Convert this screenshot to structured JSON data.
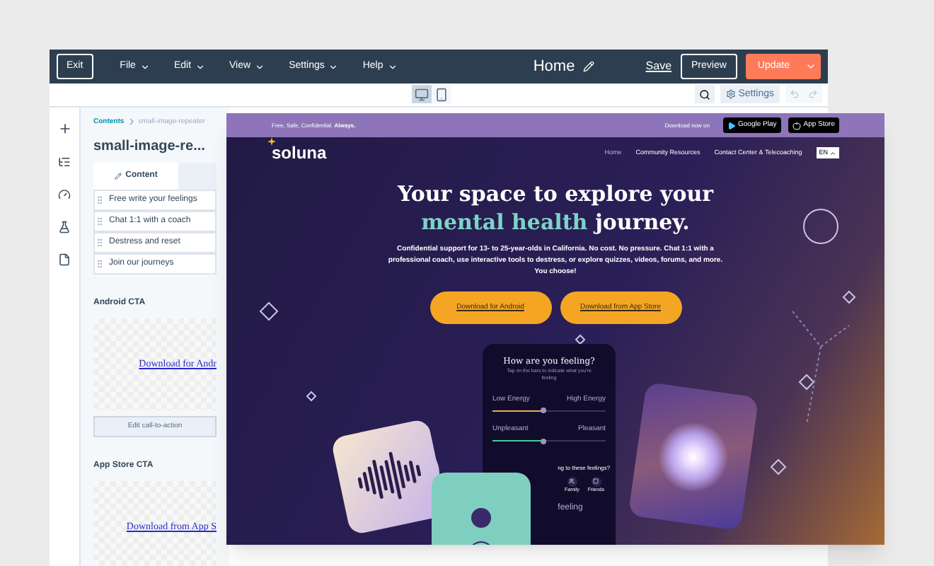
{
  "editor": {
    "exit": "Exit",
    "menus": [
      "File",
      "Edit",
      "View",
      "Settings",
      "Help"
    ],
    "page_title": "Home",
    "save": "Save",
    "preview": "Preview",
    "update": "Update",
    "devices": [
      {
        "kind": "desktop",
        "selected": true
      },
      {
        "kind": "mobile",
        "selected": false
      }
    ],
    "settings": "Settings"
  },
  "sidebar": {
    "breadcrumb": [
      "Contents",
      "small-image-repeater"
    ],
    "title": "small-image-re...",
    "tab": "Content",
    "items": [
      "Free write your feelings",
      "Chat 1:1 with a coach",
      "Destress and reset",
      "Join our journeys"
    ],
    "sections": [
      {
        "heading": "Android CTA",
        "link": "Download for Andr",
        "button": "Edit call-to-action"
      },
      {
        "heading": "App Store CTA",
        "link": "Download from App S"
      }
    ]
  },
  "site": {
    "tagline": "Free, Safe, Confidential. ",
    "tagline_bold": "Always.",
    "download_label": "Download now on",
    "stores": [
      {
        "name": "Google Play"
      },
      {
        "name": "App Store"
      }
    ],
    "logo": "soluna",
    "nav": [
      {
        "label": "Home",
        "selected": true
      },
      {
        "label": "Community Resources",
        "selected": false
      },
      {
        "label": "Contact Center & Telecoaching",
        "selected": false
      }
    ],
    "language": "EN",
    "headline_1": "Your space to explore your",
    "headline_accent": "mental health",
    "headline_2": "journey.",
    "body": "Confidential support for 13- to 25-year-olds in California. No cost. No pressure. Chat 1:1 with a professional coach, use interactive tools to destress, or explore quizzes, videos, forums, and more. You choose!",
    "ctas": [
      "Download for Android",
      "Download from App Store"
    ],
    "phone": {
      "title": "How are you feeling?",
      "hint": "Tap on the bars to indicate what you're feeling",
      "sliders": [
        {
          "low": "Low Energy",
          "high": "High Energy",
          "level": 0.45,
          "color": "#e8b04a"
        },
        {
          "low": "Unpleasant",
          "high": "Pleasant",
          "level": 0.45,
          "color": "#3ecf8e"
        }
      ],
      "question": "ng to these feelings?",
      "chips": [
        "Family",
        "Friends"
      ],
      "footer": "feeling"
    }
  }
}
